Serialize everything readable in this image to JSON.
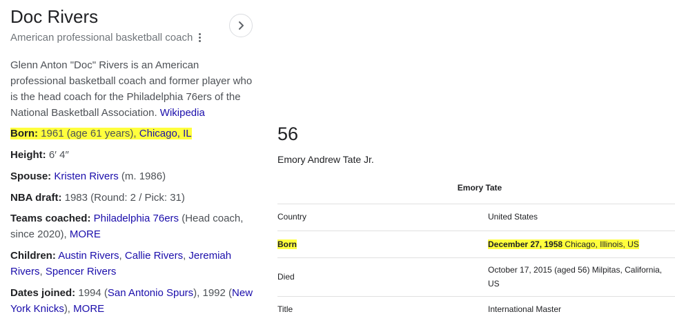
{
  "knowledge_panel": {
    "title": "Doc Rivers",
    "subtitle": "American professional basketball coach",
    "description": "Glenn Anton \"Doc\" Rivers is an American professional basketball coach and former player who is the head coach for the Philadelphia 76ers of the National Basketball Association.",
    "description_source": "Wikipedia",
    "facts": {
      "born": {
        "label": "Born:",
        "value": "1961 (age 61 years), ",
        "place": "Chicago, IL"
      },
      "height": {
        "label": "Height:",
        "value": "6′ 4″"
      },
      "spouse": {
        "label": "Spouse:",
        "link": "Kristen Rivers",
        "extra": " (m. 1986)"
      },
      "nba_draft": {
        "label": "NBA draft:",
        "value": "1983 (Round: 2 / Pick: 31)"
      },
      "teams_coached": {
        "label": "Teams coached:",
        "link": "Philadelphia 76ers",
        "extra": " (Head coach, since 2020), ",
        "more": "MORE"
      },
      "children": {
        "label": "Children:",
        "names": [
          "Austin Rivers",
          "Callie Rivers",
          "Jeremiah Rivers",
          "Spencer Rivers"
        ],
        "sep": ", "
      },
      "dates_joined": {
        "label": "Dates joined:",
        "y1": "1994 (",
        "team1": "San Antonio Spurs",
        "mid": "), 1992 (",
        "team2": "New York Knicks",
        "end": "), ",
        "more": "MORE"
      }
    },
    "icons": {
      "more_options": "more-vert-icon",
      "next": "chevron-right-icon"
    }
  },
  "infobox": {
    "heading_number": "56",
    "full_name": "Emory Andrew Tate Jr.",
    "table_title": "Emory Tate",
    "rows": {
      "country": {
        "label": "Country",
        "value": "United States"
      },
      "born": {
        "label": "Born",
        "date": "December 27, 1958",
        "place": " Chicago, Illinois, US"
      },
      "died": {
        "label": "Died",
        "value": "October 17, 2015 (aged 56) Milpitas, California, US"
      },
      "title": {
        "label": "Title",
        "value": "International Master"
      }
    }
  },
  "colors": {
    "highlight": "#ffff3d",
    "link": "#1a0dab",
    "text": "#202124",
    "muted": "#4d5156"
  }
}
